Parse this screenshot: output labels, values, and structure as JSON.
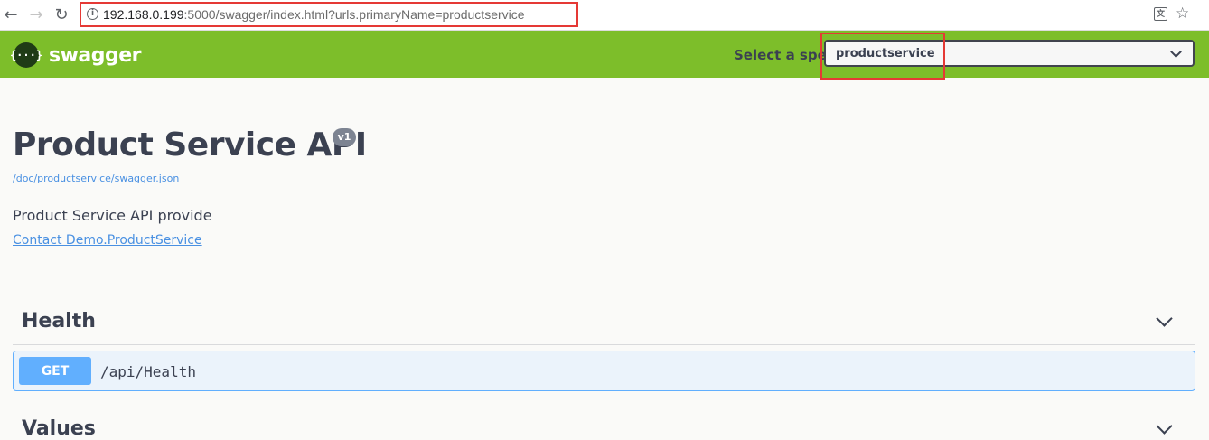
{
  "browser": {
    "back_icon": "arrow-left-icon",
    "forward_icon": "arrow-right-icon",
    "reload_icon": "reload-icon",
    "url_host": "192.168.0.199",
    "url_rest": ":5000/swagger/index.html?urls.primaryName=productservice",
    "translate_icon": "translate-icon",
    "star_icon": "star-icon"
  },
  "topbar": {
    "logo_glyph": "{···}",
    "logo_text": "swagger",
    "spec_label": "Select a spec",
    "spec_value": "productservice",
    "bg_color": "#7dbe2a"
  },
  "info": {
    "title": "Product Service API",
    "version": "v1",
    "spec_link": "/doc/productservice/swagger.json",
    "description": "Product Service API provide",
    "contact": "Contact Demo.ProductService"
  },
  "tags": [
    {
      "name": "Health",
      "operations": [
        {
          "method": "GET",
          "path": "/api/Health",
          "color": "#61affe"
        }
      ]
    },
    {
      "name": "Values",
      "operations": []
    }
  ],
  "highlight_color": "#e53935"
}
